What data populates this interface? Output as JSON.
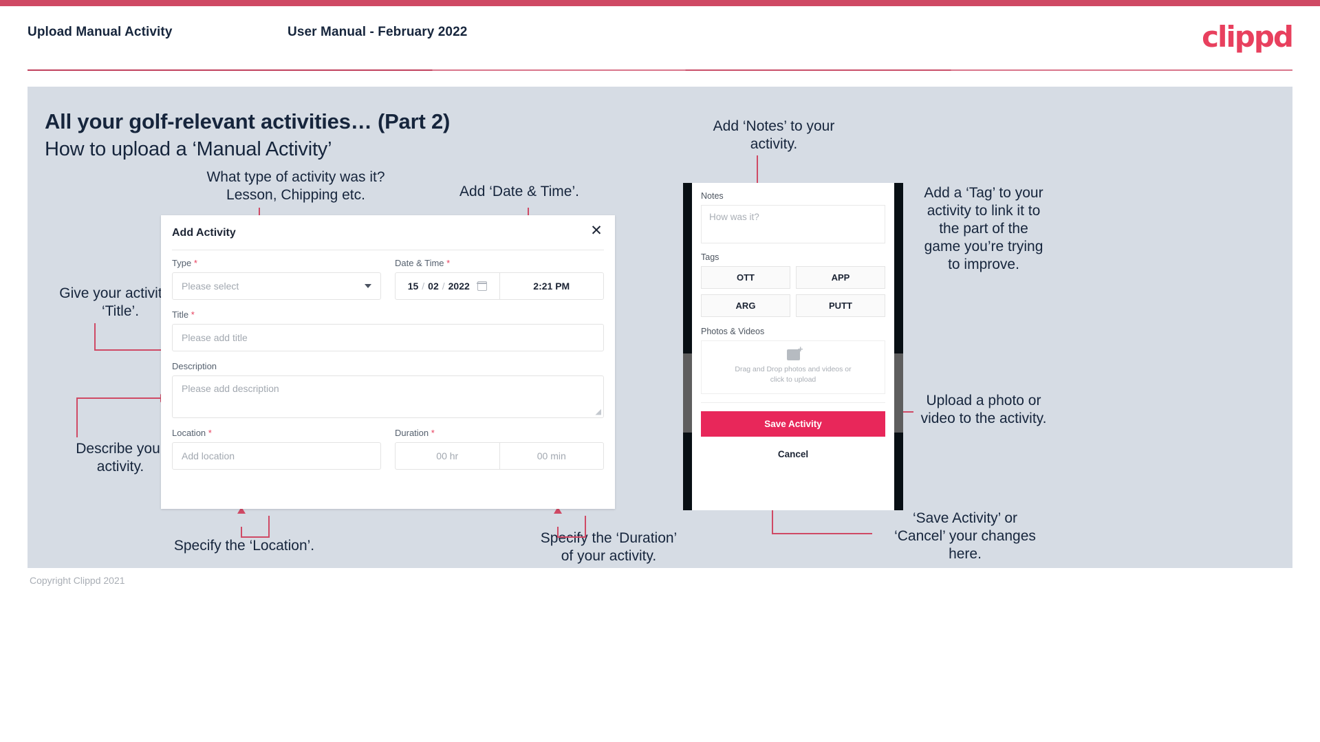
{
  "header": {
    "title": "Upload Manual Activity",
    "subtitle": "User Manual - February 2022",
    "logo": "clippd"
  },
  "slide": {
    "title": "All your golf-relevant activities… (Part 2)",
    "subtitle": "How to upload a ‘Manual Activity’"
  },
  "annotations": {
    "type": "What type of activity was it?\nLesson, Chipping etc.",
    "datetime": "Add ‘Date & Time’.",
    "title_field": "Give your activity a\n‘Title’.",
    "description": "Describe your\nactivity.",
    "location": "Specify the ‘Location’.",
    "duration": "Specify the ‘Duration’\nof your activity.",
    "notes": "Add ‘Notes’ to your\nactivity.",
    "tags": "Add a ‘Tag’ to your\nactivity to link it to\nthe part of the\ngame you’re trying\nto improve.",
    "upload": "Upload a photo or\nvideo to the activity.",
    "save_cancel": "‘Save Activity’ or\n‘Cancel’ your changes\nhere."
  },
  "dialog": {
    "title": "Add Activity",
    "close_icon": "✕",
    "fields": {
      "type": {
        "label": "Type",
        "required": "*",
        "placeholder": "Please select"
      },
      "datetime": {
        "label": "Date & Time",
        "required": "*",
        "day": "15",
        "month": "02",
        "year": "2022",
        "sep1": "/",
        "sep2": "/",
        "time": "2:21 PM"
      },
      "title": {
        "label": "Title",
        "required": "*",
        "placeholder": "Please add title"
      },
      "description": {
        "label": "Description",
        "placeholder": "Please add description"
      },
      "location": {
        "label": "Location",
        "required": "*",
        "placeholder": "Add location"
      },
      "duration": {
        "label": "Duration",
        "required": "*",
        "hours": "00 hr",
        "minutes": "00 min"
      }
    }
  },
  "phone": {
    "notes": {
      "label": "Notes",
      "placeholder": "How was it?"
    },
    "tags": {
      "label": "Tags",
      "items": [
        "OTT",
        "APP",
        "ARG",
        "PUTT"
      ]
    },
    "photos": {
      "label": "Photos & Videos",
      "drop_line1": "Drag and Drop photos and videos or",
      "drop_line2": "click to upload"
    },
    "save_label": "Save Activity",
    "cancel_label": "Cancel"
  },
  "footer": {
    "copyright": "Copyright Clippd 2021"
  },
  "colors": {
    "accent": "#cf4964",
    "brand": "#e8405e",
    "save": "#e8275a",
    "slide_bg": "#d6dce4",
    "text_dark": "#16253c"
  }
}
